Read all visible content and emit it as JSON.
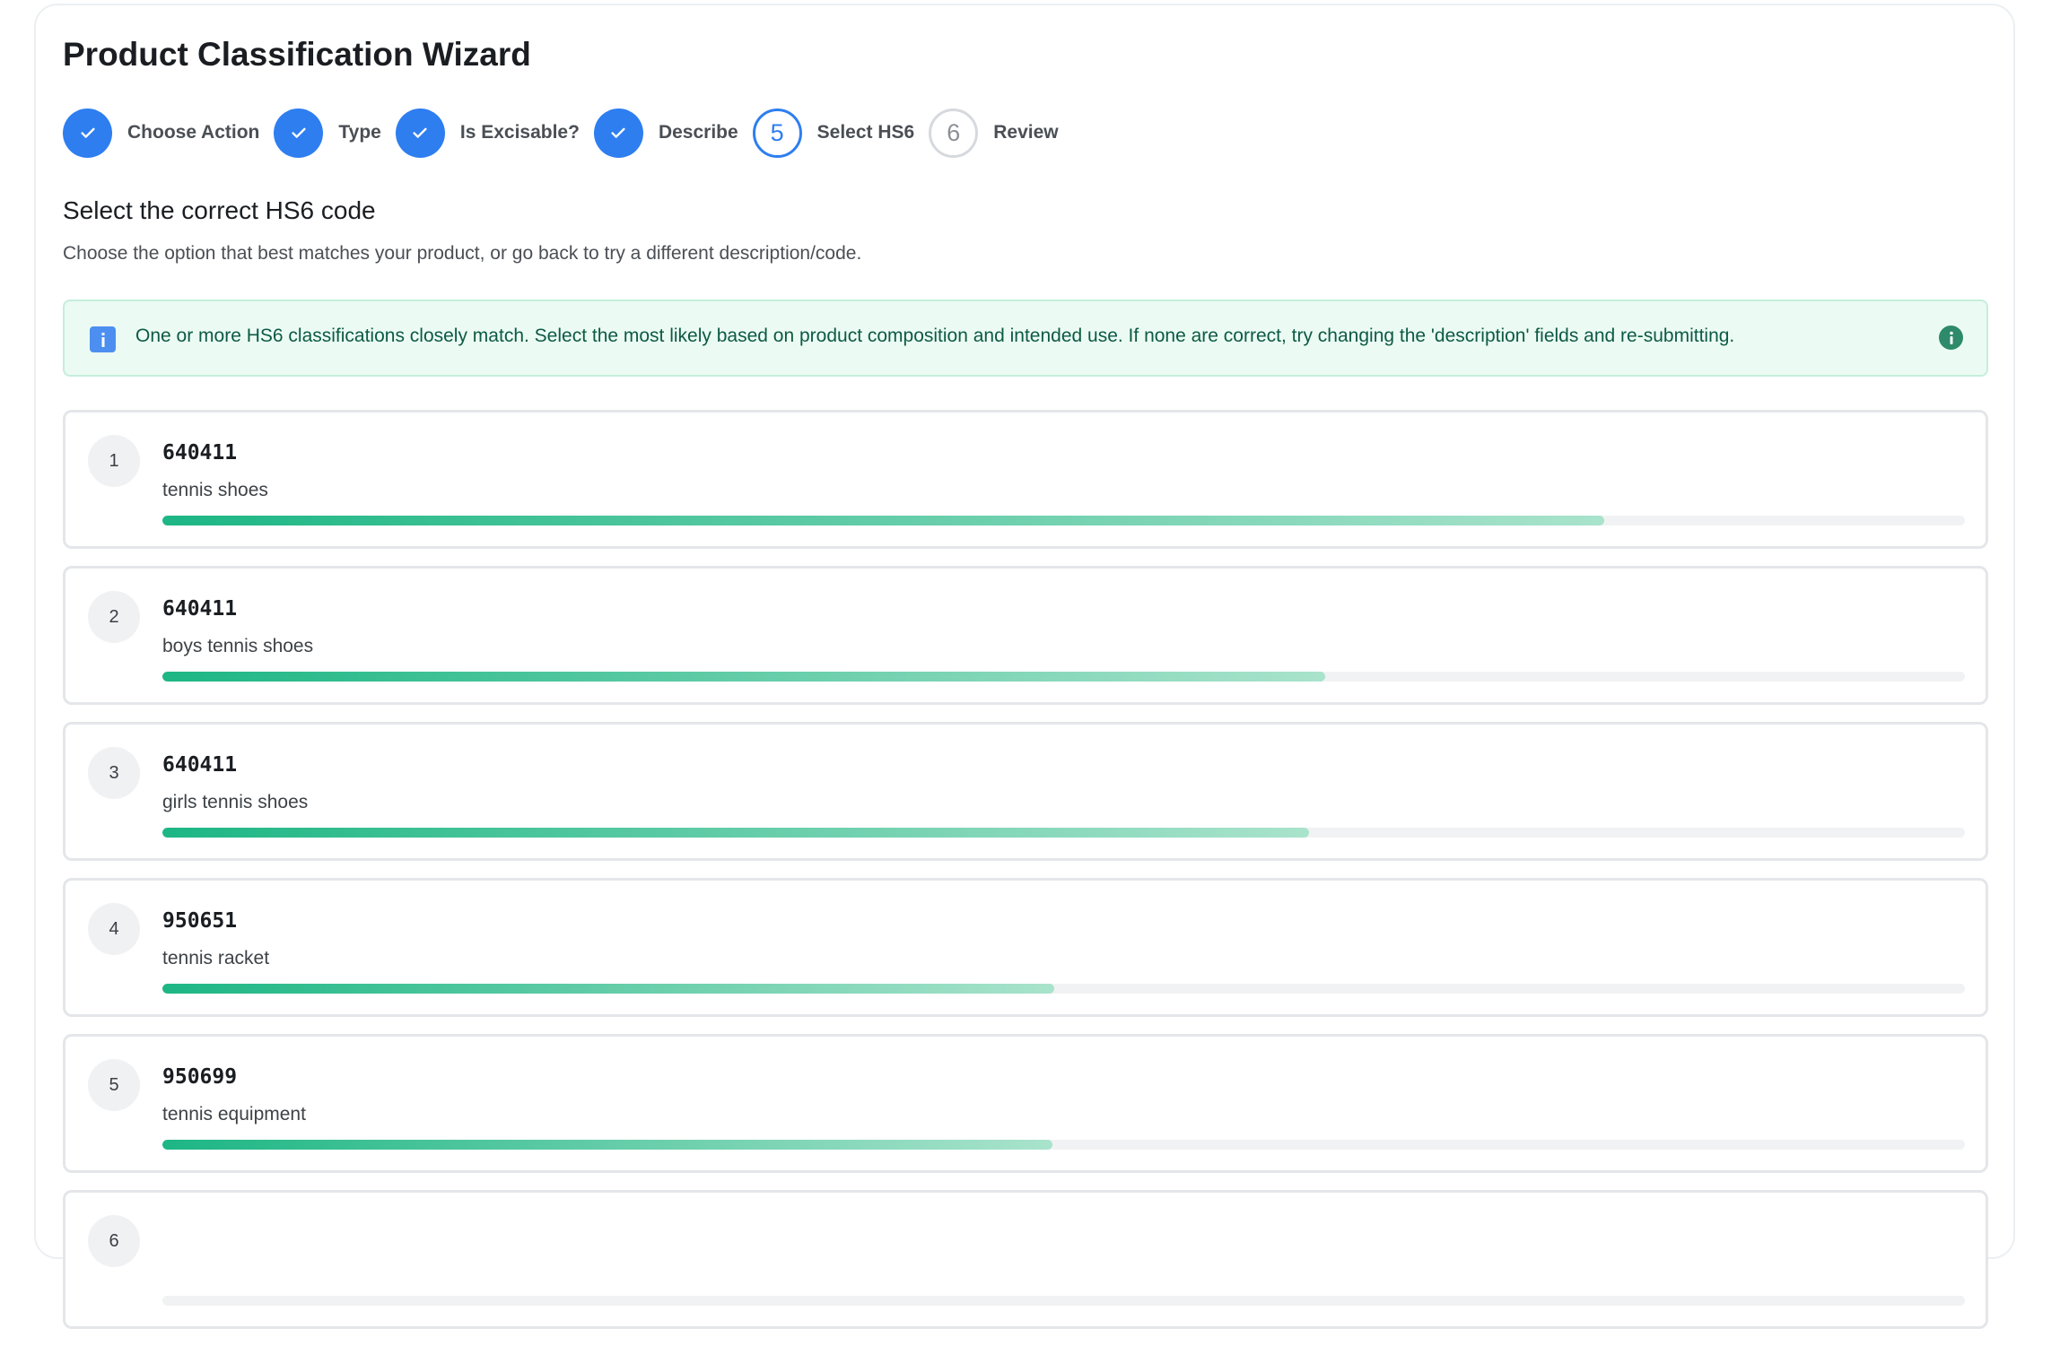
{
  "page": {
    "title": "Product Classification Wizard"
  },
  "stepper": {
    "steps": [
      {
        "label": "Choose Action",
        "status": "done",
        "number": "1"
      },
      {
        "label": "Type",
        "status": "done",
        "number": "2"
      },
      {
        "label": "Is Excisable?",
        "status": "done",
        "number": "3"
      },
      {
        "label": "Describe",
        "status": "done",
        "number": "4"
      },
      {
        "label": "Select HS6",
        "status": "active",
        "number": "5"
      },
      {
        "label": "Review",
        "status": "pending",
        "number": "6"
      }
    ]
  },
  "section": {
    "title": "Select the correct HS6 code",
    "description": "Choose the option that best matches your product, or go back to try a different description/code."
  },
  "alert": {
    "text": "One or more HS6 classifications closely match. Select the most likely based on product composition and intended use. If none are correct, try changing the 'description' fields and re-submitting.",
    "icon": "info-icon",
    "help_icon": "help-icon"
  },
  "options": [
    {
      "rank": "1",
      "code": "640411",
      "description": "tennis shoes",
      "confidence": 0.8
    },
    {
      "rank": "2",
      "code": "640411",
      "description": "boys tennis shoes",
      "confidence": 0.645
    },
    {
      "rank": "3",
      "code": "640411",
      "description": "girls tennis shoes",
      "confidence": 0.636
    },
    {
      "rank": "4",
      "code": "950651",
      "description": "tennis racket",
      "confidence": 0.495
    },
    {
      "rank": "5",
      "code": "950699",
      "description": "tennis equipment",
      "confidence": 0.494
    },
    {
      "rank": "6",
      "code": "",
      "description": "",
      "confidence": 0
    }
  ],
  "colors": {
    "primary": "#2e7ef0",
    "alert_bg": "#ebfbf4",
    "alert_text": "#0d5a44",
    "bar_start": "#1db684",
    "bar_end": "#a9e3cc"
  }
}
